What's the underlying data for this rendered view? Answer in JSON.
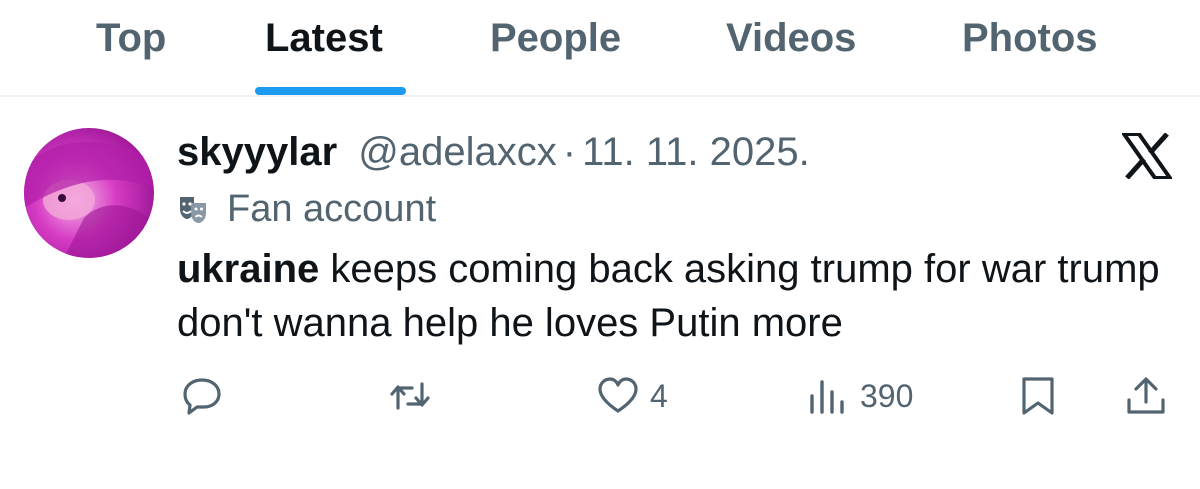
{
  "tabs": [
    {
      "label": "Top",
      "active": false
    },
    {
      "label": "Latest",
      "active": true
    },
    {
      "label": "People",
      "active": false
    },
    {
      "label": "Videos",
      "active": false
    },
    {
      "label": "Photos",
      "active": false
    }
  ],
  "tweet": {
    "display_name": "skyyylar",
    "handle": "@adelaxcx",
    "separator": "·",
    "date": "11. 11. 2025.",
    "label_icon": "theater-masks-icon",
    "label": "Fan account",
    "text_bold": "ukraine",
    "text_rest": " keeps coming back asking trump for war trump don't wanna help he loves Putin more",
    "platform_icon": "x-logo-icon"
  },
  "actions": {
    "reply_icon": "reply-icon",
    "repost_icon": "repost-icon",
    "like_icon": "like-heart-icon",
    "likes": "4",
    "views_icon": "views-chart-icon",
    "views": "390",
    "bookmark_icon": "bookmark-icon",
    "share_icon": "share-icon"
  },
  "colors": {
    "accent": "#1d9bf0",
    "primary_text": "#0f1419",
    "secondary_text": "#536471",
    "divider": "#eff3f4"
  }
}
